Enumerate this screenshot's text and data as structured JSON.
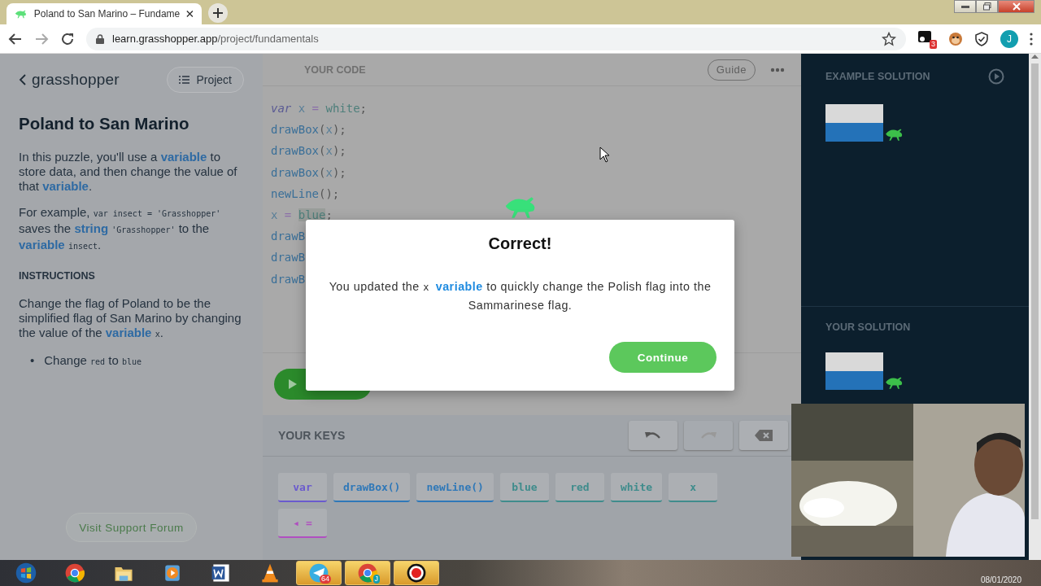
{
  "browser": {
    "tab_title": "Poland to San Marino – Fundame",
    "address_host": "learn.grasshopper.app",
    "address_path": "/project/fundamentals",
    "extension_badge": "3",
    "profile_initial": "J"
  },
  "sidebar": {
    "logo": "grasshopper",
    "project_button": "Project",
    "title": "Poland to San Marino",
    "paragraphs": [
      [
        {
          "kind": "text",
          "text": "In this puzzle, you'll use a "
        },
        {
          "kind": "term",
          "text": "variable"
        },
        {
          "kind": "text",
          "text": " to store data, and then change the value of that "
        },
        {
          "kind": "term",
          "text": "variable"
        },
        {
          "kind": "text",
          "text": "."
        }
      ],
      [
        {
          "kind": "text",
          "text": "For example, "
        },
        {
          "kind": "code",
          "text": "var insect = 'Grasshopper'"
        },
        {
          "kind": "text",
          "text": " saves the "
        },
        {
          "kind": "term",
          "text": "string "
        },
        {
          "kind": "code",
          "text": "'Grasshopper'"
        },
        {
          "kind": "text",
          "text": " to the "
        },
        {
          "kind": "term",
          "text": "variable "
        },
        {
          "kind": "code",
          "text": "insect"
        },
        {
          "kind": "text",
          "text": "."
        }
      ]
    ],
    "instructions_heading": "INSTRUCTIONS",
    "instructions": [
      [
        {
          "kind": "text",
          "text": "Change the flag of Poland to be the simplified flag of San Marino by changing the value of the "
        },
        {
          "kind": "term",
          "text": "variable "
        },
        {
          "kind": "code",
          "text": "x"
        },
        {
          "kind": "text",
          "text": "."
        }
      ]
    ],
    "bullets": [
      {
        "marker": "•",
        "segments": [
          {
            "kind": "text",
            "text": "Change "
          },
          {
            "kind": "code",
            "text": "red"
          },
          {
            "kind": "text",
            "text": " to "
          },
          {
            "kind": "code",
            "text": "blue"
          }
        ]
      }
    ],
    "support_button": "Visit Support Forum"
  },
  "editor": {
    "header": "YOUR CODE",
    "guide_button": "Guide",
    "lines": [
      [
        {
          "kind": "keyword",
          "text": "var"
        },
        {
          "kind": "ident",
          "text": " x "
        },
        {
          "kind": "op",
          "text": "="
        },
        {
          "kind": "value",
          "text": " white"
        },
        {
          "kind": "punct",
          "text": ";"
        }
      ],
      [
        {
          "kind": "func",
          "text": "drawBox"
        },
        {
          "kind": "punct",
          "text": "("
        },
        {
          "kind": "ident",
          "text": "x"
        },
        {
          "kind": "punct",
          "text": ");"
        }
      ],
      [
        {
          "kind": "func",
          "text": "drawBox"
        },
        {
          "kind": "punct",
          "text": "("
        },
        {
          "kind": "ident",
          "text": "x"
        },
        {
          "kind": "punct",
          "text": ");"
        }
      ],
      [
        {
          "kind": "func",
          "text": "drawBox"
        },
        {
          "kind": "punct",
          "text": "("
        },
        {
          "kind": "ident",
          "text": "x"
        },
        {
          "kind": "punct",
          "text": ");"
        }
      ],
      [
        {
          "kind": "func",
          "text": "newLine"
        },
        {
          "kind": "punct",
          "text": "();"
        }
      ],
      [
        {
          "kind": "ident",
          "text": "x "
        },
        {
          "kind": "op",
          "text": "= "
        },
        {
          "kind": "selected-value",
          "text": "blue"
        },
        {
          "kind": "punct",
          "text": ";"
        }
      ],
      [
        {
          "kind": "func",
          "text": "drawB"
        }
      ],
      [
        {
          "kind": "func",
          "text": "drawB"
        }
      ],
      [
        {
          "kind": "func",
          "text": "drawB"
        }
      ]
    ]
  },
  "keys": {
    "header": "YOUR KEYS",
    "items": [
      {
        "label": "var",
        "color": "#6a5acd"
      },
      {
        "label": "drawBox()",
        "color": "#2f78b8"
      },
      {
        "label": "newLine()",
        "color": "#2f78b8"
      },
      {
        "label": "blue",
        "color": "#3f8c8c"
      },
      {
        "label": "red",
        "color": "#3f8c8c"
      },
      {
        "label": "white",
        "color": "#3f8c8c"
      },
      {
        "label": "x",
        "color": "#3f8c8c"
      },
      {
        "label": "◂ =",
        "color": "#b04fc0"
      }
    ]
  },
  "solutions": [
    {
      "title": "EXAMPLE SOLUTION"
    },
    {
      "title": "YOUR SOLUTION"
    }
  ],
  "dialog": {
    "title": "Correct!",
    "message": [
      {
        "kind": "text",
        "text": "You updated the "
      },
      {
        "kind": "code",
        "text": "x "
      },
      {
        "kind": "term",
        "text": "variable"
      },
      {
        "kind": "text",
        "text": " to quickly change the Polish flag into the Sammarinese flag."
      }
    ],
    "button": "Continue"
  },
  "taskbar": {
    "items": [
      {
        "kind": "start",
        "active": false
      },
      {
        "kind": "chrome",
        "active": false
      },
      {
        "kind": "folder",
        "active": false
      },
      {
        "kind": "media",
        "active": false
      },
      {
        "kind": "word",
        "active": false
      },
      {
        "kind": "vlc",
        "active": false
      },
      {
        "kind": "telegram",
        "active": true,
        "badge": "64"
      },
      {
        "kind": "chrome",
        "active": true,
        "badge": "J"
      },
      {
        "kind": "recorder",
        "active": true
      }
    ],
    "date": "08/01/2020"
  }
}
